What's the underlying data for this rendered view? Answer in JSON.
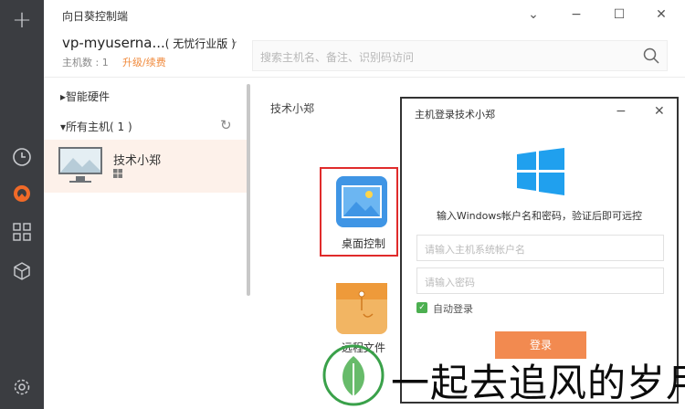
{
  "app": {
    "title": "向日葵控制端"
  },
  "account": {
    "name": "vp-myuserna...",
    "version": "( 无忧行业版 )",
    "host_count_label": "主机数 : 1",
    "upgrade_link": "升级/续费"
  },
  "search": {
    "placeholder": "搜索主机名、备注、识别码访问"
  },
  "sidebar": {
    "smart_hardware": "智能硬件",
    "all_hosts": "所有主机( 1 )",
    "hosts": [
      {
        "name": "技术小郑"
      }
    ]
  },
  "main": {
    "host_title": "技术小郑",
    "tiles": [
      {
        "label": "桌面控制"
      },
      {
        "label": "远程文件"
      }
    ]
  },
  "dialog": {
    "title": "主机登录技术小郑",
    "message": "输入Windows帐户名和密码，验证后即可远控",
    "username_placeholder": "请输入主机系统帐户名",
    "password_placeholder": "请输入密码",
    "autologin_label": "自动登录",
    "autologin_checked": true,
    "login_button": "登录"
  },
  "watermark": {
    "text": "一起去追风的岁月"
  },
  "colors": {
    "accent": "#f28a50",
    "rail": "#3b3d41",
    "highlight": "#e02b2b",
    "selected_row": "#fdf1ea"
  },
  "icons": [
    "plus-icon",
    "clock-icon",
    "remote-icon",
    "apps-icon",
    "cube-icon",
    "settings-icon",
    "search-icon",
    "refresh-icon",
    "windows-icon",
    "checkbox-icon"
  ]
}
